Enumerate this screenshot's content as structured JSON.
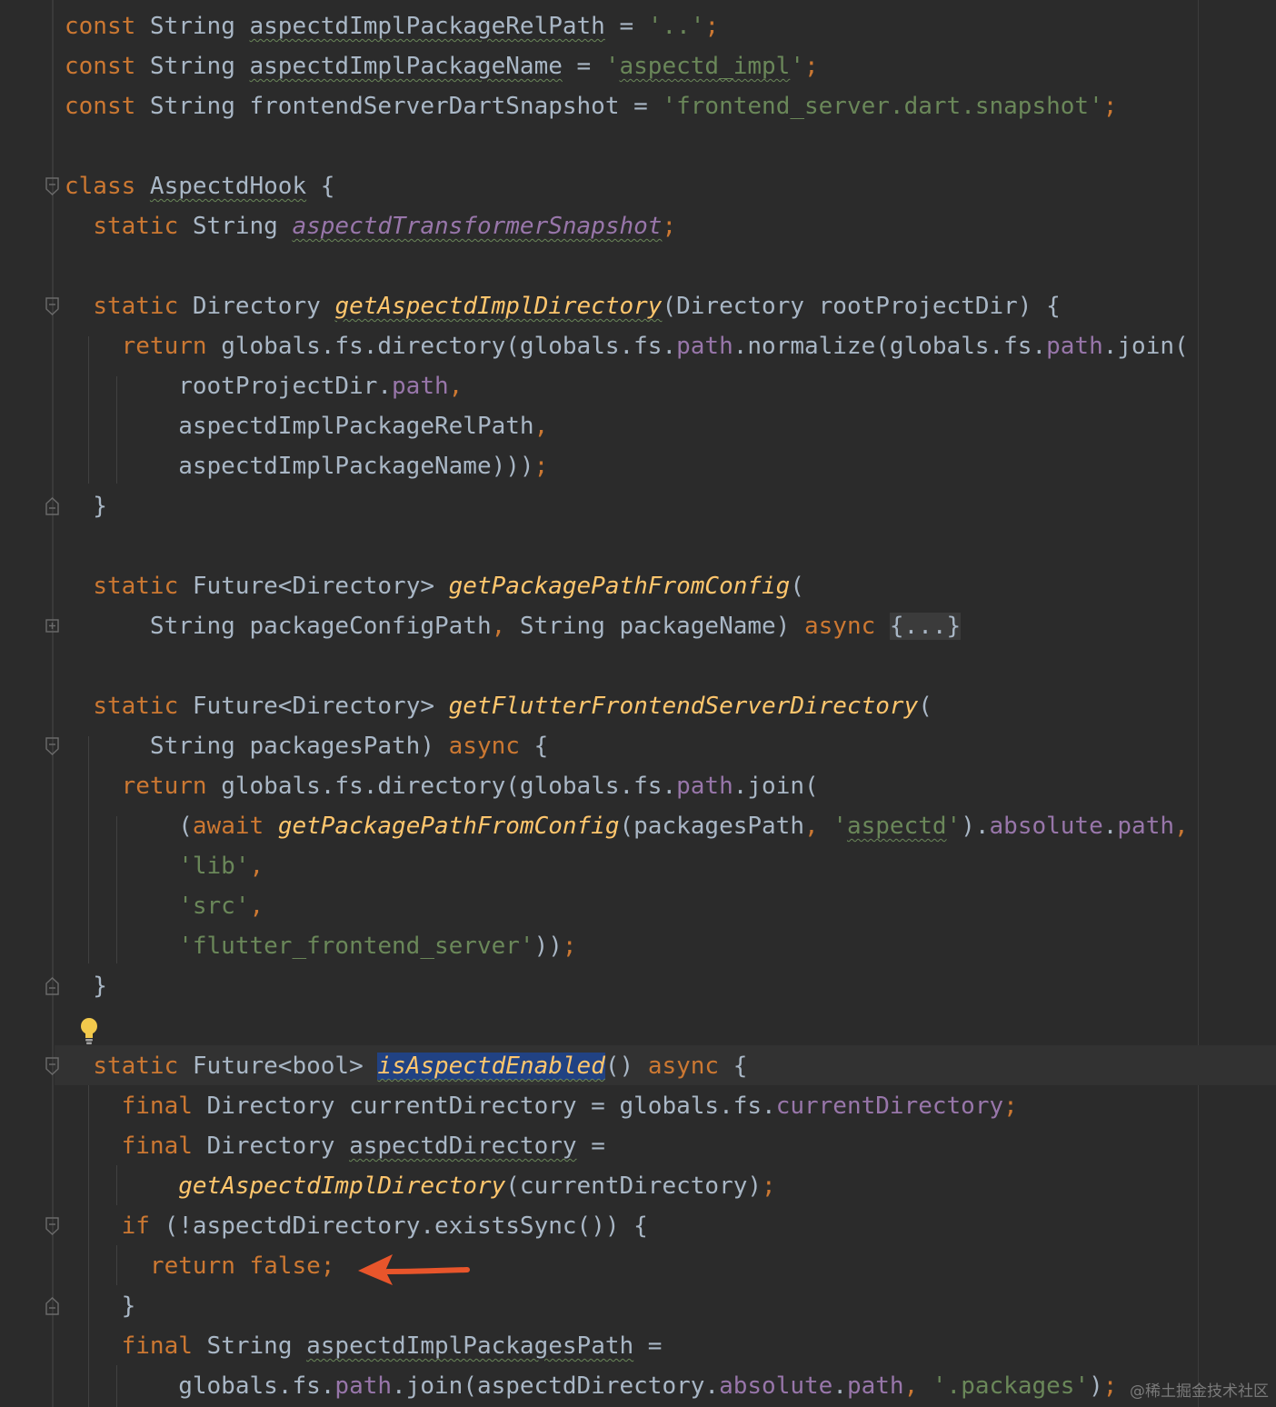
{
  "editor": {
    "language": "dart",
    "colors": {
      "background": "#2b2b2b",
      "keyword": "#cc7832",
      "identifier": "#a9b7c6",
      "function": "#ffc66d",
      "field": "#9876aa",
      "string": "#6a8759",
      "selection": "#214283",
      "annotation_arrow": "#e8552b"
    },
    "lines": [
      [
        [
          "kw",
          "const "
        ],
        [
          "id",
          "String "
        ],
        [
          "idw",
          "aspectdImplPackageRelPath"
        ],
        [
          "id",
          " = "
        ],
        [
          "str",
          "'..'"
        ],
        [
          "kw",
          ";"
        ]
      ],
      [
        [
          "kw",
          "const "
        ],
        [
          "id",
          "String "
        ],
        [
          "idw",
          "aspectdImplPackageName"
        ],
        [
          "id",
          " = "
        ],
        [
          "str",
          "'"
        ],
        [
          "strw",
          "aspectd_impl"
        ],
        [
          "str",
          "'"
        ],
        [
          "kw",
          ";"
        ]
      ],
      [
        [
          "kw",
          "const "
        ],
        [
          "id",
          "String "
        ],
        [
          "id",
          "frontendServerDartSnapshot"
        ],
        [
          "id",
          " = "
        ],
        [
          "str",
          "'frontend_server.dart.snapshot'"
        ],
        [
          "kw",
          ";"
        ]
      ],
      [],
      [
        [
          "kw",
          "class "
        ],
        [
          "idw",
          "AspectdHook"
        ],
        [
          "id",
          " {"
        ]
      ],
      [
        [
          "id",
          "  "
        ],
        [
          "kw",
          "static "
        ],
        [
          "id",
          "String "
        ],
        [
          "statw",
          "aspectdTransformerSnapshot"
        ],
        [
          "kw",
          ";"
        ]
      ],
      [],
      [
        [
          "id",
          "  "
        ],
        [
          "kw",
          "static "
        ],
        [
          "id",
          "Directory "
        ],
        [
          "fnw",
          "getAspectdImplDirectory"
        ],
        [
          "id",
          "(Directory rootProjectDir) {"
        ]
      ],
      [
        [
          "id",
          "    "
        ],
        [
          "kw",
          "return "
        ],
        [
          "id",
          "globals.fs.directory(globals.fs."
        ],
        [
          "fld",
          "path"
        ],
        [
          "id",
          ".normalize(globals.fs."
        ],
        [
          "fld",
          "path"
        ],
        [
          "id",
          ".join("
        ]
      ],
      [
        [
          "id",
          "        rootProjectDir."
        ],
        [
          "fld",
          "path"
        ],
        [
          "kw",
          ","
        ]
      ],
      [
        [
          "id",
          "        aspectdImplPackageRelPath"
        ],
        [
          "kw",
          ","
        ]
      ],
      [
        [
          "id",
          "        aspectdImplPackageName)))"
        ],
        [
          "kw",
          ";"
        ]
      ],
      [
        [
          "id",
          "  }"
        ]
      ],
      [],
      [
        [
          "id",
          "  "
        ],
        [
          "kw",
          "static "
        ],
        [
          "id",
          "Future<Directory> "
        ],
        [
          "fn",
          "getPackagePathFromConfig"
        ],
        [
          "id",
          "("
        ]
      ],
      [
        [
          "id",
          "      String packageConfigPath"
        ],
        [
          "kw",
          ", "
        ],
        [
          "id",
          "String packageName) "
        ],
        [
          "kw",
          "async "
        ],
        [
          "fold",
          "{...}"
        ]
      ],
      [],
      [
        [
          "id",
          "  "
        ],
        [
          "kw",
          "static "
        ],
        [
          "id",
          "Future<Directory> "
        ],
        [
          "fn",
          "getFlutterFrontendServerDirectory"
        ],
        [
          "id",
          "("
        ]
      ],
      [
        [
          "id",
          "      String packagesPath) "
        ],
        [
          "kw",
          "async "
        ],
        [
          "id",
          "{"
        ]
      ],
      [
        [
          "id",
          "    "
        ],
        [
          "kw",
          "return "
        ],
        [
          "id",
          "globals.fs.directory(globals.fs."
        ],
        [
          "fld",
          "path"
        ],
        [
          "id",
          ".join("
        ]
      ],
      [
        [
          "id",
          "        ("
        ],
        [
          "kw",
          "await "
        ],
        [
          "fn",
          "getPackagePathFromConfig"
        ],
        [
          "id",
          "(packagesPath"
        ],
        [
          "kw",
          ", "
        ],
        [
          "str",
          "'"
        ],
        [
          "strw",
          "aspectd"
        ],
        [
          "str",
          "'"
        ],
        [
          "id",
          ")."
        ],
        [
          "fld",
          "absolute"
        ],
        [
          "id",
          "."
        ],
        [
          "fld",
          "path"
        ],
        [
          "kw",
          ","
        ]
      ],
      [
        [
          "str",
          "        'lib'"
        ],
        [
          "kw",
          ","
        ]
      ],
      [
        [
          "str",
          "        'src'"
        ],
        [
          "kw",
          ","
        ]
      ],
      [
        [
          "str",
          "        'flutter_frontend_server'"
        ],
        [
          "id",
          "))"
        ],
        [
          "kw",
          ";"
        ]
      ],
      [
        [
          "id",
          "  }"
        ]
      ],
      [],
      [
        [
          "id",
          "  "
        ],
        [
          "kw",
          "static "
        ],
        [
          "id",
          "Future<bool> "
        ],
        [
          "fnsel",
          "isAspectdEnabled"
        ],
        [
          "id",
          "() "
        ],
        [
          "kw",
          "async "
        ],
        [
          "id",
          "{"
        ]
      ],
      [
        [
          "id",
          "    "
        ],
        [
          "kw",
          "final "
        ],
        [
          "id",
          "Directory currentDirectory = globals.fs."
        ],
        [
          "fld",
          "currentDirectory"
        ],
        [
          "kw",
          ";"
        ]
      ],
      [
        [
          "id",
          "    "
        ],
        [
          "kw",
          "final "
        ],
        [
          "id",
          "Directory "
        ],
        [
          "idw",
          "aspectdDirectory"
        ],
        [
          "id",
          " ="
        ]
      ],
      [
        [
          "id",
          "        "
        ],
        [
          "fn",
          "getAspectdImplDirectory"
        ],
        [
          "id",
          "(currentDirectory)"
        ],
        [
          "kw",
          ";"
        ]
      ],
      [
        [
          "id",
          "    "
        ],
        [
          "kw",
          "if "
        ],
        [
          "id",
          "(!aspectdDirectory.existsSync()) {"
        ]
      ],
      [
        [
          "id",
          "      "
        ],
        [
          "kw",
          "return false;"
        ]
      ],
      [
        [
          "id",
          "    }"
        ]
      ],
      [
        [
          "id",
          "    "
        ],
        [
          "kw",
          "final "
        ],
        [
          "id",
          "String "
        ],
        [
          "idw",
          "aspectdImplPackagesPath"
        ],
        [
          "id",
          " ="
        ]
      ],
      [
        [
          "id",
          "        globals.fs."
        ],
        [
          "fld",
          "path"
        ],
        [
          "id",
          ".join(aspectdDirectory."
        ],
        [
          "fld",
          "absolute"
        ],
        [
          "id",
          "."
        ],
        [
          "fld",
          "path"
        ],
        [
          "kw",
          ", "
        ],
        [
          "str",
          "'.packages'"
        ],
        [
          "id",
          ")"
        ],
        [
          "kw",
          ";"
        ]
      ]
    ],
    "fold_markers": [
      {
        "line": 4,
        "icon": "fold-start-icon"
      },
      {
        "line": 7,
        "icon": "fold-start-icon"
      },
      {
        "line": 12,
        "icon": "fold-end-icon"
      },
      {
        "line": 15,
        "icon": "fold-expand-icon"
      },
      {
        "line": 18,
        "icon": "fold-start-icon"
      },
      {
        "line": 24,
        "icon": "fold-end-icon"
      },
      {
        "line": 26,
        "icon": "fold-start-icon"
      },
      {
        "line": 30,
        "icon": "fold-start-icon"
      },
      {
        "line": 32,
        "icon": "fold-end-icon"
      }
    ],
    "intention_bulb_icon": "lightbulb-icon",
    "annotation_icon": "red-arrow-icon",
    "watermark": "@稀土掘金技术社区"
  }
}
